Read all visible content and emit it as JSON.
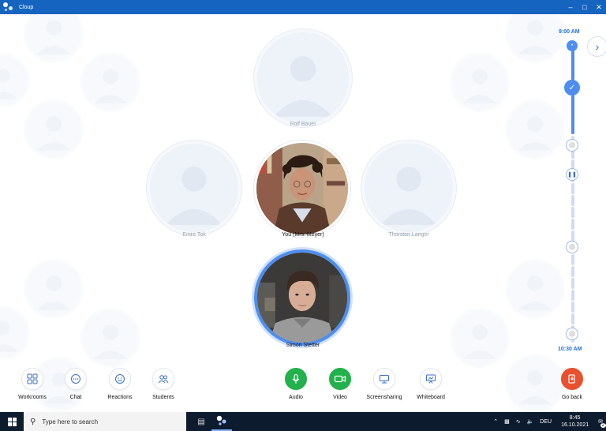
{
  "window": {
    "title": "Cloup",
    "minimize_icon": "minimize-icon",
    "maximize_icon": "maximize-icon",
    "close_icon": "close-icon"
  },
  "participants": {
    "top": "Rolf Bauer",
    "left": "Emre Tok",
    "center": "You (Mrs. Meyer)",
    "right": "Thorsten Langer",
    "speaker": "Simon Stetter"
  },
  "timeline": {
    "start": "9:00 AM",
    "end": "10:30 AM",
    "progress": 0.12
  },
  "toolbar": {
    "workrooms": "Workrooms",
    "chat": "Chat",
    "reactions": "Reactions",
    "students": "Students",
    "audio": "Audio",
    "video": "Video",
    "screensharing": "Screensharing",
    "whiteboard": "Whiteboard",
    "goback": "Go back"
  },
  "taskbar": {
    "search_placeholder": "Type here to search",
    "language": "DEU",
    "time": "8:45",
    "date": "16.10.2021",
    "notification_count": "2"
  },
  "colors": {
    "accent": "#1e6fd9",
    "green": "#22b14c",
    "red": "#e8502e",
    "titlebar": "#1565c0"
  }
}
